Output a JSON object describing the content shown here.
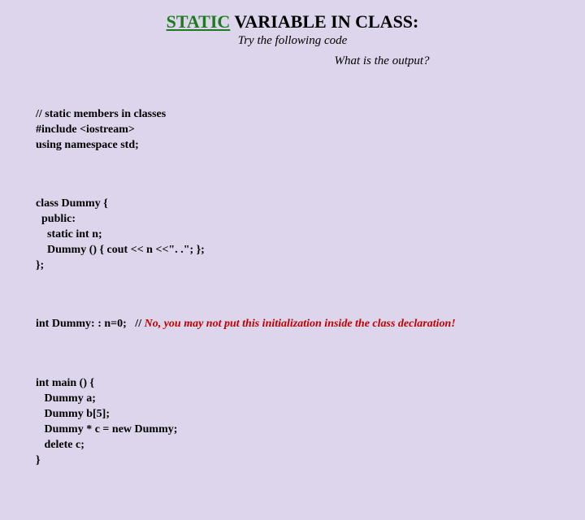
{
  "title": {
    "static": "STATIC",
    "rest": " VARIABLE IN CLASS:"
  },
  "subtitle": "Try the following code",
  "question": "What is the output?",
  "code": {
    "block1": "// static members in classes\n#include <iostream>\nusing namespace std;",
    "block2": "class Dummy {\n  public:\n    static int n;\n    Dummy () { cout << n <<\". .\"; };\n};",
    "init_prefix": "int Dummy: : n=0;   // ",
    "init_comment": "No, you may not put this initialization inside the class declaration!",
    "block4": "int main () {\n   Dummy a;\n   Dummy b[5];\n   Dummy * c = new Dummy;\n   delete c;\n}"
  }
}
